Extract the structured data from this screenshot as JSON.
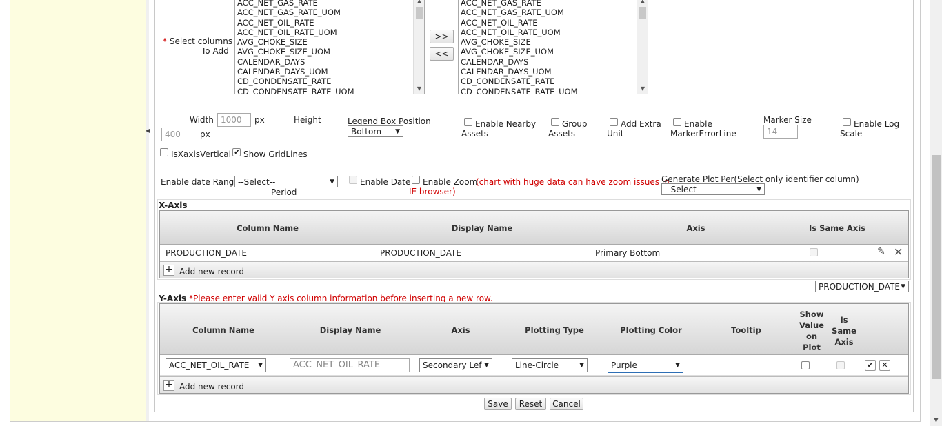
{
  "columns_section": {
    "required_mark": "*",
    "label_line1": "Select columns",
    "label_line2": "To Add",
    "available": [
      "ACC_NET_GAS_RATE",
      "ACC_NET_GAS_RATE_UOM",
      "ACC_NET_OIL_RATE",
      "ACC_NET_OIL_RATE_UOM",
      "AVG_CHOKE_SIZE",
      "AVG_CHOKE_SIZE_UOM",
      "CALENDAR_DAYS",
      "CALENDAR_DAYS_UOM",
      "CD_CONDENSATE_RATE",
      "CD_CONDENSATE_RATE_UOM"
    ],
    "selected": [
      "ACC_NET_GAS_RATE",
      "ACC_NET_GAS_RATE_UOM",
      "ACC_NET_OIL_RATE",
      "ACC_NET_OIL_RATE_UOM",
      "AVG_CHOKE_SIZE",
      "AVG_CHOKE_SIZE_UOM",
      "CALENDAR_DAYS",
      "CALENDAR_DAYS_UOM",
      "CD_CONDENSATE_RATE",
      "CD_CONDENSATE_RATE_UOM"
    ],
    "add_label": ">>",
    "remove_label": "<<"
  },
  "options": {
    "width_label": "Width",
    "width_value": "1000",
    "px": "px",
    "height_label": "Height",
    "height_value": "400",
    "legend_label": "Legend Box Position",
    "legend_value": "Bottom",
    "nearby_line1": "Enable Nearby",
    "nearby_line2": "Assets",
    "group_line1": "Group",
    "group_line2": "Assets",
    "extra_line1": "Add Extra",
    "extra_line2": "Unit",
    "marker_err_line1": "Enable",
    "marker_err_line2": "MarkerErrorLine",
    "marker_size_label": "Marker Size",
    "marker_size_value": "14",
    "log_line1": "Enable Log",
    "log_line2": "Scale",
    "isxaxis_label": "IsXaxisVertical",
    "gridlines_label": "Show GridLines",
    "date_range_label": "Enable date Range",
    "date_range_value": "--Select--",
    "period_label": "Period",
    "enable_date_label": "Enable Date",
    "enable_zoom_label": "Enable Zoom",
    "zoom_warning_line1": "(chart with huge data can have zoom issues in",
    "zoom_warning_line2": "IE browser)",
    "plot_per_label": "Generate Plot Per(Select only identifier column)",
    "plot_per_value": "--Select--"
  },
  "x_axis": {
    "title": "X-Axis",
    "headers": [
      "Column Name",
      "Display Name",
      "Axis",
      "Is Same Axis"
    ],
    "row": {
      "column": "PRODUCTION_DATE",
      "display": "PRODUCTION_DATE",
      "axis": "Primary Bottom"
    },
    "add_record": "Add new record",
    "edit_icon": "pencil-icon",
    "delete_icon": "close-icon"
  },
  "x_select_value": "PRODUCTION_DATE",
  "y_axis": {
    "title": "Y-Axis",
    "warning": "*Please enter valid Y axis column information before inserting a new row.",
    "headers": {
      "column": "Column Name",
      "display": "Display Name",
      "axis": "Axis",
      "plot_type": "Plotting Type",
      "plot_color": "Plotting Color",
      "tooltip": "Tooltip",
      "show_value_1": "Show",
      "show_value_2": "Value",
      "show_value_3": "on",
      "show_value_4": "Plot",
      "same_axis_1": "Is",
      "same_axis_2": "Same",
      "same_axis_3": "Axis"
    },
    "row": {
      "column": "ACC_NET_OIL_RATE",
      "display": "ACC_NET_OIL_RATE",
      "axis": "Secondary Lef",
      "plot_type": "Line-Circle",
      "plot_color": "Purple"
    },
    "add_record": "Add new record"
  },
  "actions": {
    "save": "Save",
    "reset": "Reset",
    "cancel": "Cancel"
  },
  "icons": {
    "check": "check-icon",
    "cancel": "close-icon",
    "plus": "plus-icon"
  }
}
